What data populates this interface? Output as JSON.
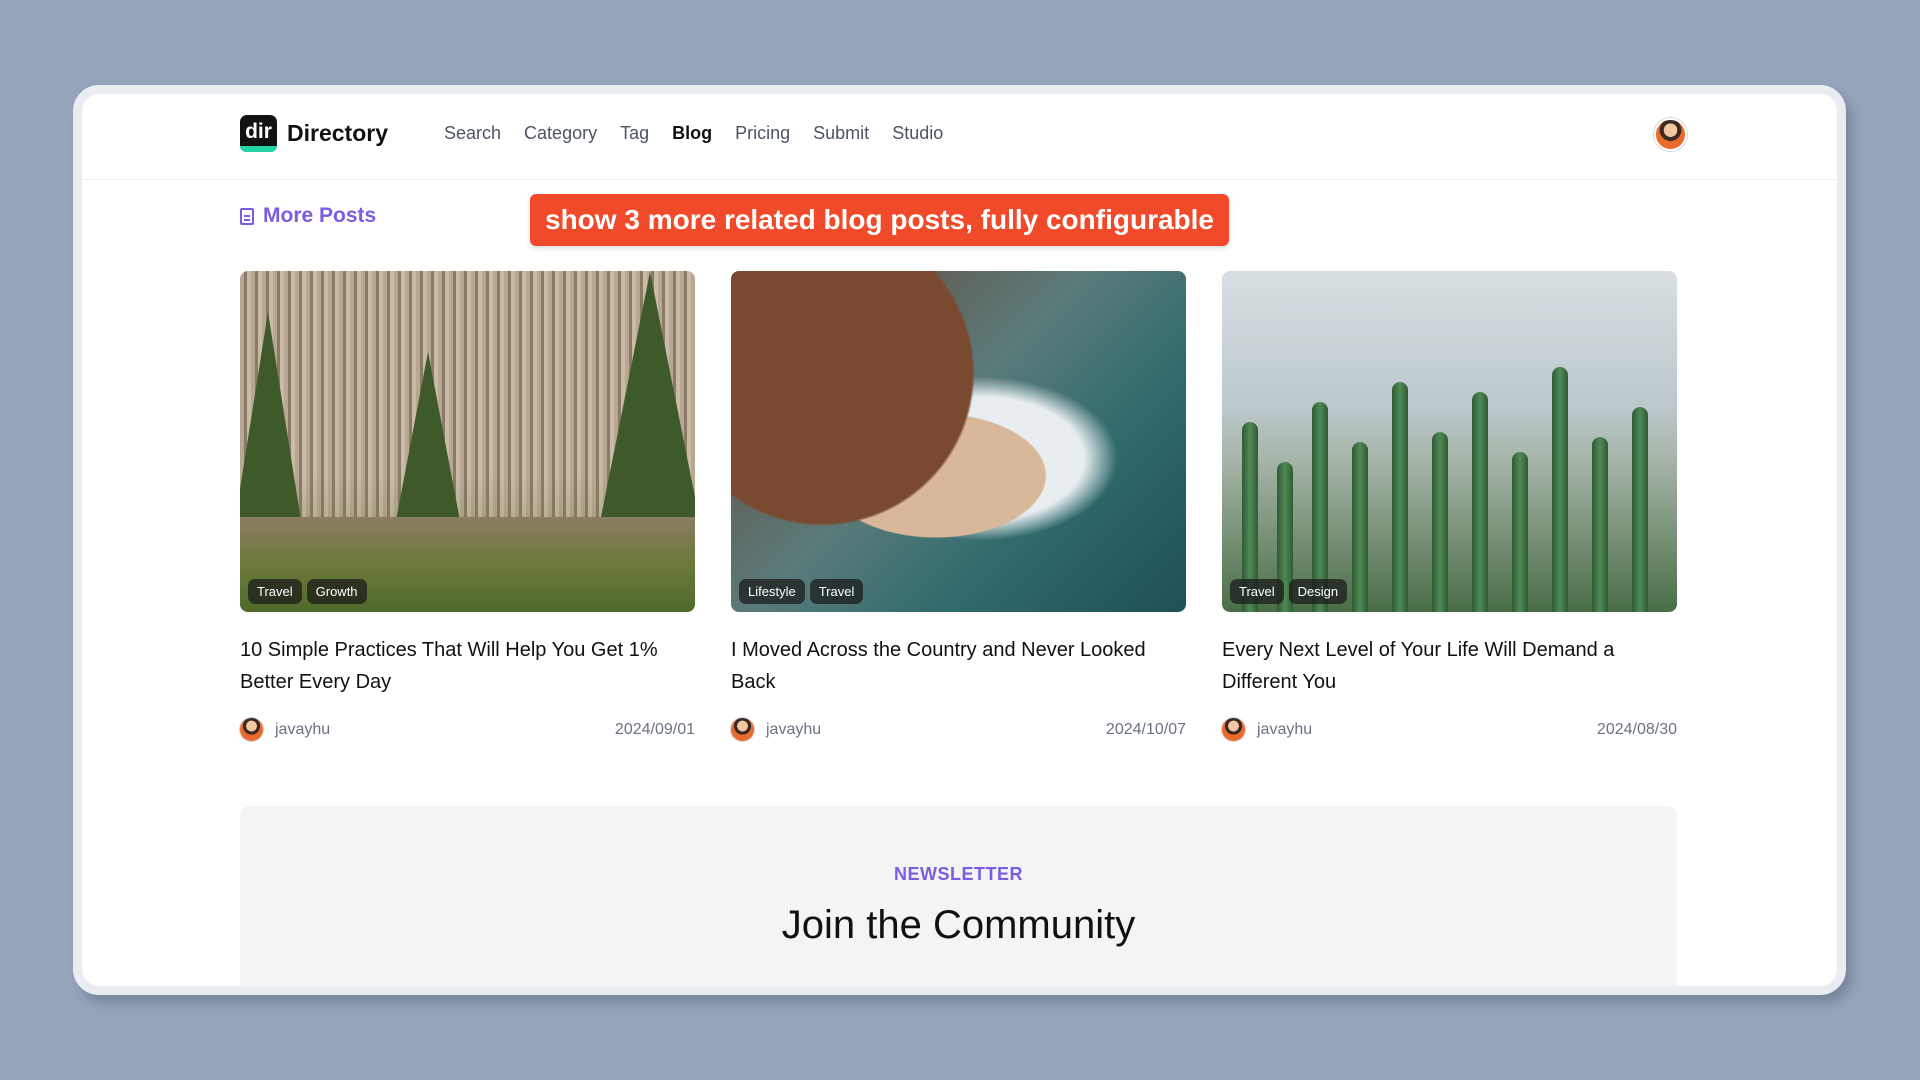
{
  "header": {
    "logo_mark": "dir",
    "logo_text": "Directory",
    "nav": [
      "Search",
      "Category",
      "Tag",
      "Blog",
      "Pricing",
      "Submit",
      "Studio"
    ],
    "active_nav": "Blog"
  },
  "section": {
    "title": "More Posts",
    "callout": "show 3 more related blog posts, fully configurable"
  },
  "posts": [
    {
      "title": "10 Simple Practices That Will Help You Get 1% Better Every Day",
      "tags": [
        "Travel",
        "Growth"
      ],
      "author": "javayhu",
      "date": "2024/09/01"
    },
    {
      "title": "I Moved Across the Country and Never Looked Back",
      "tags": [
        "Lifestyle",
        "Travel"
      ],
      "author": "javayhu",
      "date": "2024/10/07"
    },
    {
      "title": "Every Next Level of Your Life Will Demand a Different You",
      "tags": [
        "Travel",
        "Design"
      ],
      "author": "javayhu",
      "date": "2024/08/30"
    }
  ],
  "newsletter": {
    "kicker": "NEWSLETTER",
    "title": "Join the Community"
  },
  "colors": {
    "accent": "#7c5ce0",
    "callout": "#f14a2b",
    "background": "#95a4bb"
  }
}
